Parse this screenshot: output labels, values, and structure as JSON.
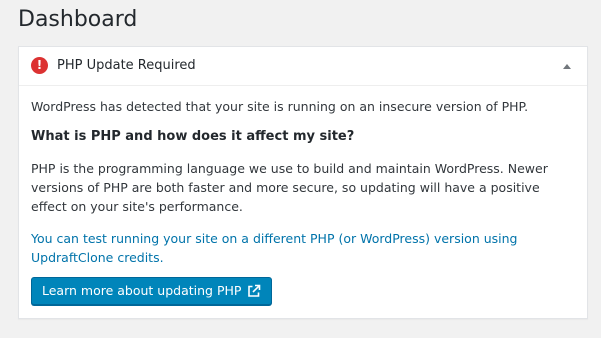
{
  "page": {
    "title": "Dashboard"
  },
  "widget": {
    "alert_icon": "error-exclamation",
    "alert_glyph": "!",
    "title": "PHP Update Required",
    "toggle_icon": "triangle-up",
    "detected_text": "WordPress has detected that your site is running on an insecure version of PHP.",
    "heading": "What is PHP and how does it affect my site?",
    "body_text": "PHP is the programming language we use to build and maintain WordPress. Newer versions of PHP are both faster and more secure, so updating will have a positive effect on your site's performance.",
    "link_text": "You can test running your site on a different PHP (or WordPress) version using UpdraftClone credits.",
    "button_label": "Learn more about updating PHP",
    "button_icon": "external-link"
  },
  "colors": {
    "background": "#f1f1f1",
    "alert": "#dc3232",
    "link": "#0073aa",
    "button": "#0085ba"
  }
}
